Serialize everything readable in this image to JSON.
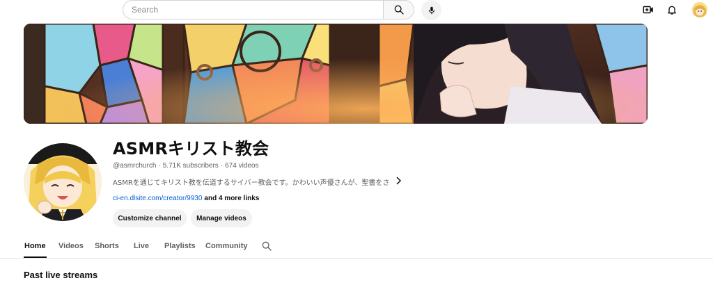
{
  "search": {
    "placeholder": "Search"
  },
  "channel": {
    "name": "ASMRキリスト教会",
    "handle": "@asmrchurch",
    "subscribers": "5.71K subscribers",
    "videos": "674 videos",
    "description": "ASMRを通じてキリスト教を伝道するサイバー教会です。かわいい声優さんが、聖書をさ…",
    "link": "ci-en.dlsite.com/creator/9930",
    "more_links": "and 4 more links"
  },
  "buttons": {
    "customize": "Customize channel",
    "manage": "Manage videos"
  },
  "tabs": [
    {
      "label": "Home"
    },
    {
      "label": "Videos"
    },
    {
      "label": "Shorts"
    },
    {
      "label": "Live"
    },
    {
      "label": "Playlists"
    },
    {
      "label": "Community"
    }
  ],
  "section": {
    "title": "Past live streams"
  },
  "icons": {
    "search": "search-icon",
    "mic": "mic-icon",
    "create": "create-video-icon",
    "bell": "bell-icon",
    "chevron": "chevron-right-icon"
  },
  "colors": {
    "link": "#065fd4",
    "text": "#0f0f0f",
    "muted": "#606060"
  }
}
